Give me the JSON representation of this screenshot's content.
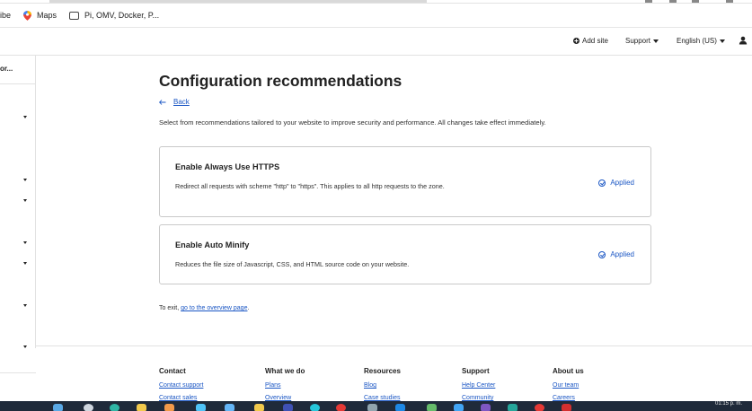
{
  "browser": {
    "bookmarks": [
      {
        "label": "ibe",
        "icon": "partial"
      },
      {
        "label": "Maps",
        "icon": "maps-pin-icon"
      },
      {
        "label": "Pi, OMV, Docker, P...",
        "icon": "folder-icon"
      }
    ]
  },
  "header": {
    "add_site": "Add site",
    "support": "Support",
    "language": "English (US)",
    "user_icon": "user-icon"
  },
  "sidebar": {
    "account": "or..."
  },
  "main": {
    "title": "Configuration recommendations",
    "back": "Back",
    "description": "Select from recommendations tailored to your website to improve security and performance. All changes take effect immediately.",
    "cards": [
      {
        "title": "Enable Always Use HTTPS",
        "description": "Redirect all requests with scheme \"http\" to \"https\". This applies to all http requests to the zone.",
        "status": "Applied"
      },
      {
        "title": "Enable Auto Minify",
        "description": "Reduces the file size of Javascript, CSS, and HTML source code on your website.",
        "status": "Applied"
      }
    ],
    "exit_prefix": "To exit,",
    "exit_link": "go to the overview page",
    "exit_suffix": "."
  },
  "footer": {
    "columns": [
      {
        "heading": "Contact",
        "links": [
          "Contact support",
          "Contact sales"
        ]
      },
      {
        "heading": "What we do",
        "links": [
          "Plans",
          "Overview"
        ]
      },
      {
        "heading": "Resources",
        "links": [
          "Blog",
          "Case studies"
        ]
      },
      {
        "heading": "Support",
        "links": [
          "Help Center",
          "Community"
        ]
      },
      {
        "heading": "About us",
        "links": [
          "Our team",
          "Careers"
        ]
      }
    ]
  },
  "taskbar": {
    "clock": "01:15 p. m."
  },
  "colors": {
    "link": "#1a56c4",
    "text": "#313131",
    "border": "#c9c9c9",
    "taskbar": "#1f2a3a"
  }
}
